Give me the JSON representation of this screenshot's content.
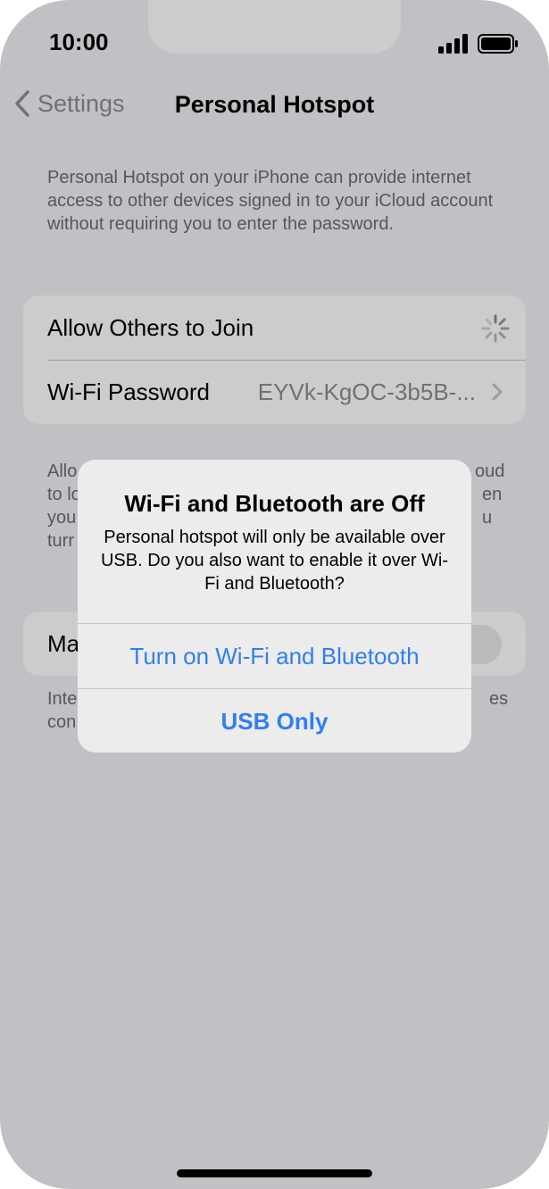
{
  "status": {
    "time": "10:00",
    "icons": [
      "signal-bars-icon",
      "battery-icon"
    ]
  },
  "nav": {
    "back_label": "Settings",
    "title": "Personal Hotspot"
  },
  "description": "Personal Hotspot on your iPhone can provide internet access to other devices signed in to your iCloud account without requiring you to enter the password.",
  "settings": {
    "allow_others_label": "Allow Others to Join",
    "wifi_password_label": "Wi-Fi Password",
    "wifi_password_value": "EYVk-KgOC-3b5B-..."
  },
  "footer1": {
    "line1": "Allo",
    "line1_end": "oud",
    "line2": "to lo",
    "line2_end": "en",
    "line3": "you",
    "line3_end": "u",
    "line4": "turr"
  },
  "maximize_row_label": "Ma",
  "footer2": {
    "line1": "Inte",
    "line1_end": "es",
    "line2": "con"
  },
  "alert": {
    "title": "Wi-Fi and Bluetooth are Off",
    "message": "Personal hotspot will only be available over USB. Do you also want to enable it over Wi-Fi and Bluetooth?",
    "primary_button": "Turn on Wi-Fi and Bluetooth",
    "secondary_button": "USB Only"
  },
  "colors": {
    "accent": "#2f7ff6",
    "background": "#f2f2f7",
    "secondary_text": "#8e8e93"
  }
}
